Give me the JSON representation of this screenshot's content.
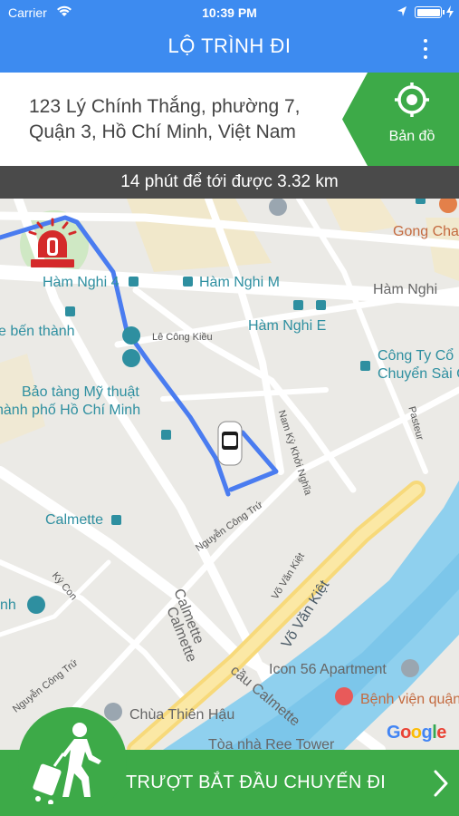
{
  "status_bar": {
    "carrier": "Carrier",
    "time": "10:39 PM"
  },
  "nav": {
    "title": "LỘ TRÌNH ĐI"
  },
  "destination": {
    "address_line1": "123 Lý Chính Thắng, phường 7,",
    "address_line2": "Quận 3, Hồ Chí Minh, Việt Nam"
  },
  "map_button": {
    "label": "Bản đồ"
  },
  "eta": {
    "text": "14 phút để tới được 3.32 km"
  },
  "map": {
    "labels": {
      "ham_nghi_4": "Hàm Nghi 4",
      "ham_nghi_m": "Hàm Nghi M",
      "ham_nghi": "Hàm Nghi",
      "ham_nghi_e": "Hàm Nghi E",
      "ben_thanh": "e bến thành",
      "le_cong_kieu": "Lê Công Kiều",
      "cong_ty": "Công Ty Cổ",
      "chuyen_sai": "Chuyển Sài C",
      "bao_tang": "Bảo tàng Mỹ thuật",
      "bao_tang2": "hành phố Hồ Chí Minh",
      "nam_ky": "Nam Kỳ Khởi Nghĩa",
      "pasteur": "Pasteur",
      "gong_cha": "Gong Cha",
      "calmette": "Calmette",
      "nguyen_cong_tru": "Nguyễn Công Trứ",
      "ky_con": "Ký Con",
      "calmette_street1": "Calmette",
      "calmette_street2": "Calmette",
      "vo_van_kiet1": "Võ Văn Kiệt",
      "vo_van_kiet2": "Võ Văn Kiệt",
      "nh": "nh",
      "nguyen_cong_tru2": "Nguyễn Công Trứ",
      "cau_calmette": "cầu Calmette",
      "icon56": "Icon 56 Apartment",
      "benh_vien": "Bệnh viện quận",
      "chua": "Chùa Thiên Hậu",
      "ree": "Tòa nhà Ree Tower"
    },
    "google": [
      "G",
      "o",
      "o",
      "g",
      "l",
      "e"
    ],
    "google_colors": [
      "#4285F4",
      "#EA4335",
      "#FBBC05",
      "#4285F4",
      "#34A853",
      "#EA4335"
    ]
  },
  "start_trip": {
    "label": "TRƯỢT BẮT ĐẦU CHUYẾN ĐI"
  },
  "colors": {
    "primary_blue": "#3d8bf0",
    "green": "#3daa48",
    "route": "#4a7cf0",
    "eta_bg": "#4a4a4a"
  }
}
